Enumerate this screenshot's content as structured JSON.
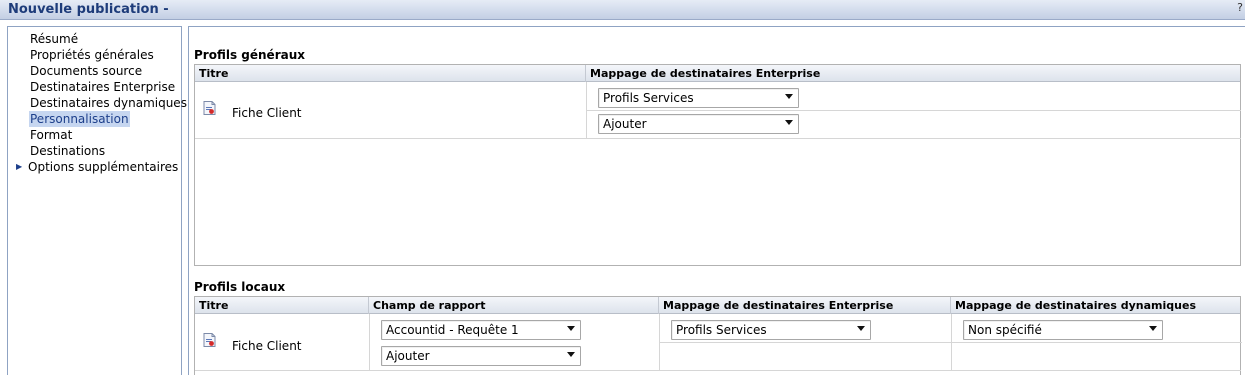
{
  "window": {
    "title": "Nouvelle publication -",
    "help": "?"
  },
  "sidebar": {
    "items": [
      {
        "label": "Résumé"
      },
      {
        "label": "Propriétés générales"
      },
      {
        "label": "Documents source"
      },
      {
        "label": "Destinataires Enterprise"
      },
      {
        "label": "Destinataires dynamiques"
      },
      {
        "label": "Personnalisation",
        "selected": true
      },
      {
        "label": "Format"
      },
      {
        "label": "Destinations"
      },
      {
        "label": "Options supplémentaires",
        "expandable": true
      }
    ]
  },
  "global_profiles": {
    "section_title": "Profils généraux",
    "columns": [
      "Titre",
      "Mappage de destinataires Enterprise"
    ],
    "rows": [
      {
        "title": "Fiche Client",
        "enterprise_mapping": "Profils Services",
        "add_value": "Ajouter"
      }
    ]
  },
  "local_profiles": {
    "section_title": "Profils locaux",
    "columns": [
      "Titre",
      "Champ de rapport",
      "Mappage de destinataires Enterprise",
      "Mappage de destinataires dynamiques"
    ],
    "rows": [
      {
        "title": "Fiche Client",
        "report_field": "Accountid - Requête 1",
        "report_add_value": "Ajouter",
        "enterprise_mapping": "Profils Services",
        "dynamic_mapping": "Non spécifié"
      }
    ]
  }
}
